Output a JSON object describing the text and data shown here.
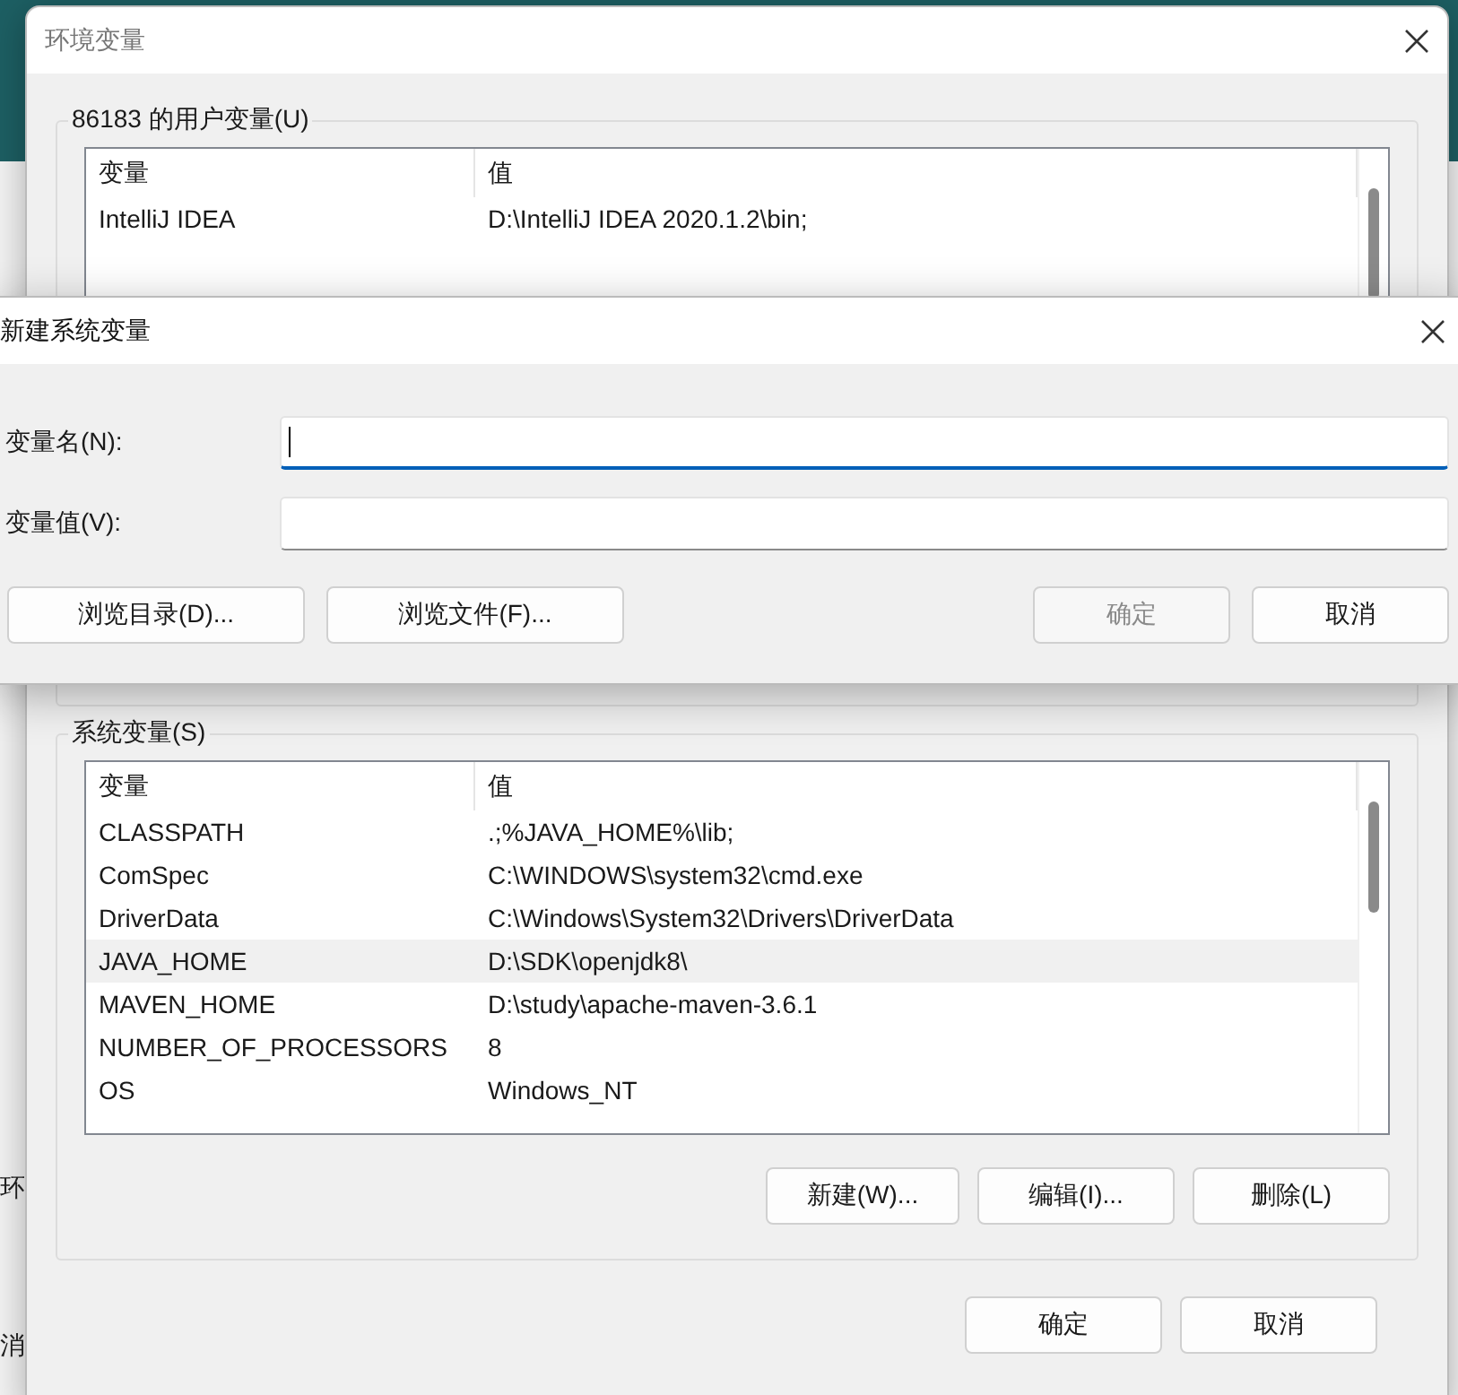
{
  "background_window": {
    "fragments": [
      "环",
      "消"
    ]
  },
  "env_window": {
    "title": "环境变量",
    "user_variables": {
      "title": "86183 的用户变量(U)",
      "columns": [
        "变量",
        "值"
      ],
      "rows": [
        {
          "name": "IntelliJ IDEA",
          "value": "D:\\IntelliJ IDEA 2020.1.2\\bin;",
          "selected": false
        }
      ]
    },
    "system_variables": {
      "title": "系统变量(S)",
      "columns": [
        "变量",
        "值"
      ],
      "rows": [
        {
          "name": "CLASSPATH",
          "value": ".;%JAVA_HOME%\\lib;",
          "selected": false
        },
        {
          "name": "ComSpec",
          "value": "C:\\WINDOWS\\system32\\cmd.exe",
          "selected": false
        },
        {
          "name": "DriverData",
          "value": "C:\\Windows\\System32\\Drivers\\DriverData",
          "selected": false
        },
        {
          "name": "JAVA_HOME",
          "value": "D:\\SDK\\openjdk8\\",
          "selected": true
        },
        {
          "name": "MAVEN_HOME",
          "value": "D:\\study\\apache-maven-3.6.1",
          "selected": false
        },
        {
          "name": "NUMBER_OF_PROCESSORS",
          "value": "8",
          "selected": false
        },
        {
          "name": "OS",
          "value": "Windows_NT",
          "selected": false
        }
      ],
      "buttons": [
        {
          "label": "新建(W)...",
          "disabled": false
        },
        {
          "label": "编辑(I)...",
          "disabled": false
        },
        {
          "label": "删除(L)",
          "disabled": false
        }
      ]
    },
    "buttons": [
      {
        "label": "确定",
        "disabled": false
      },
      {
        "label": "取消",
        "disabled": false
      }
    ]
  },
  "new_variable_dialog": {
    "title": "新建系统变量",
    "fields": [
      {
        "label": "变量名(N):",
        "focused": true
      },
      {
        "label": "变量值(V):",
        "focused": false
      }
    ],
    "left_buttons": [
      {
        "label": "浏览目录(D)...",
        "disabled": false
      },
      {
        "label": "浏览文件(F)...",
        "disabled": false
      }
    ],
    "right_buttons": [
      {
        "label": "确定",
        "disabled": true
      },
      {
        "label": "取消",
        "disabled": false
      }
    ]
  }
}
